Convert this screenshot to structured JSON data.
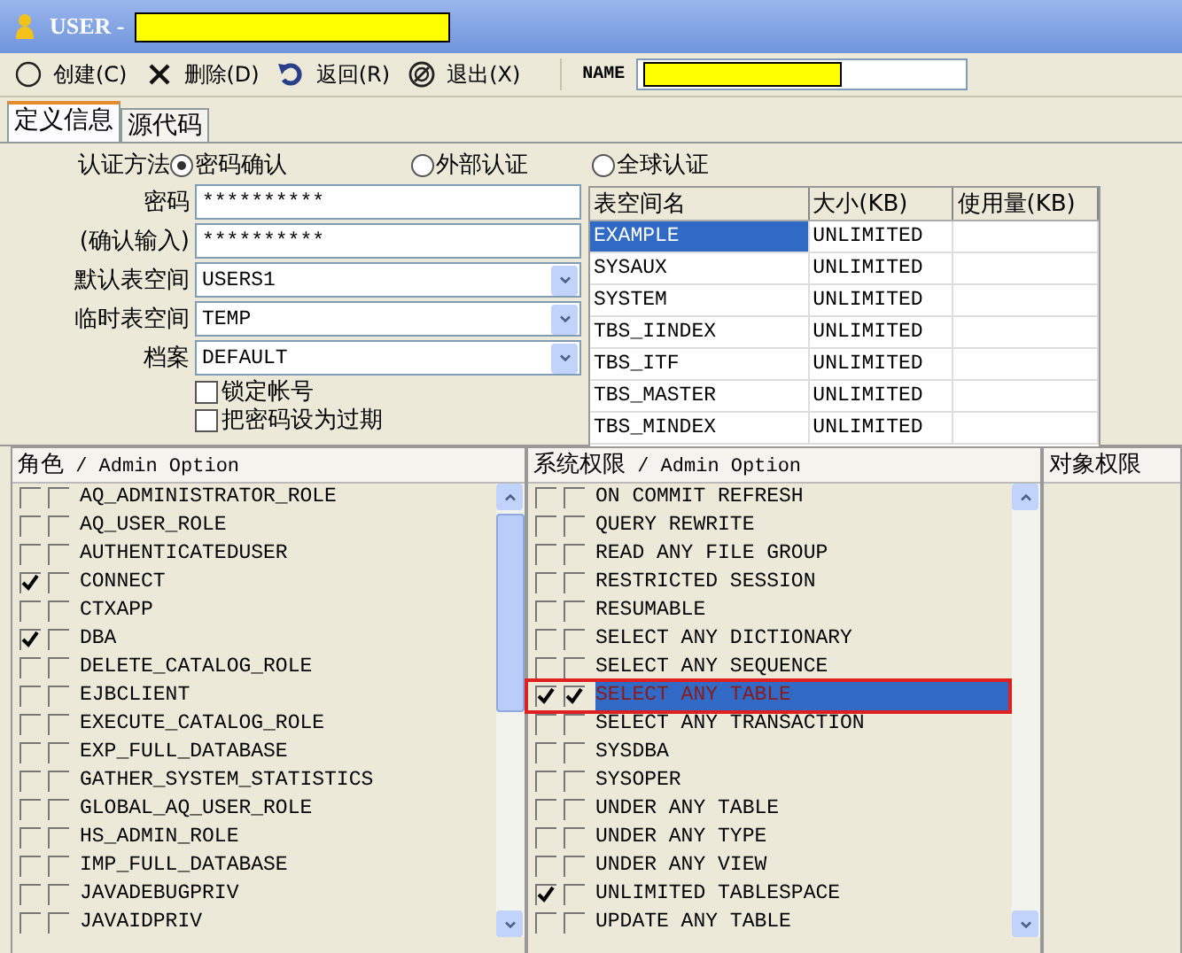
{
  "window": {
    "title": "USER -",
    "redacted": true
  },
  "toolbar": {
    "buttons": [
      {
        "label": "创建(C)"
      },
      {
        "label": "删除(D)"
      },
      {
        "label": "返回(R)"
      },
      {
        "label": "退出(X)"
      }
    ],
    "name_field": {
      "label": "NAME",
      "redacted": true
    }
  },
  "tabs": [
    {
      "label": "定义信息",
      "selected": true
    },
    {
      "label": "源代码",
      "selected": false
    }
  ],
  "auth": {
    "label": "认证方法",
    "options": [
      {
        "label": "密码确认",
        "selected": true
      },
      {
        "label": "外部认证",
        "selected": false
      },
      {
        "label": "全球认证",
        "selected": false
      }
    ]
  },
  "fields": [
    {
      "label": "密码",
      "kind": "password",
      "value": "**********"
    },
    {
      "label": "(确认输入)",
      "kind": "password",
      "value": "**********"
    },
    {
      "label": "默认表空间",
      "kind": "select",
      "value": "USERS1"
    },
    {
      "label": "临时表空间",
      "kind": "select",
      "value": "TEMP"
    },
    {
      "label": "档案",
      "kind": "select",
      "value": "DEFAULT"
    }
  ],
  "checkboxes": [
    {
      "label": "锁定帐号",
      "checked": false
    },
    {
      "label": "把密码设为过期",
      "checked": false
    }
  ],
  "tablespaces": {
    "columns": [
      "表空间名",
      "大小(KB)",
      "使用量(KB)"
    ],
    "rows": [
      {
        "name": "EXAMPLE",
        "size": "UNLIMITED",
        "selected": true
      },
      {
        "name": "SYSAUX",
        "size": "UNLIMITED",
        "selected": false
      },
      {
        "name": "SYSTEM",
        "size": "UNLIMITED",
        "selected": false
      },
      {
        "name": "TBS_IINDEX",
        "size": "UNLIMITED",
        "selected": false
      },
      {
        "name": "TBS_ITF",
        "size": "UNLIMITED",
        "selected": false
      },
      {
        "name": "TBS_MASTER",
        "size": "UNLIMITED",
        "selected": false
      },
      {
        "name": "TBS_MINDEX",
        "size": "UNLIMITED",
        "selected": false
      }
    ]
  },
  "roles": {
    "header": "角色 / Admin Option",
    "rows": [
      {
        "name": "AQ_ADMINISTRATOR_ROLE",
        "granted": false,
        "admin": false
      },
      {
        "name": "AQ_USER_ROLE",
        "granted": false,
        "admin": false
      },
      {
        "name": "AUTHENTICATEDUSER",
        "granted": false,
        "admin": false
      },
      {
        "name": "CONNECT",
        "granted": true,
        "admin": false
      },
      {
        "name": "CTXAPP",
        "granted": false,
        "admin": false
      },
      {
        "name": "DBA",
        "granted": true,
        "admin": false
      },
      {
        "name": "DELETE_CATALOG_ROLE",
        "granted": false,
        "admin": false
      },
      {
        "name": "EJBCLIENT",
        "granted": false,
        "admin": false
      },
      {
        "name": "EXECUTE_CATALOG_ROLE",
        "granted": false,
        "admin": false
      },
      {
        "name": "EXP_FULL_DATABASE",
        "granted": false,
        "admin": false
      },
      {
        "name": "GATHER_SYSTEM_STATISTICS",
        "granted": false,
        "admin": false
      },
      {
        "name": "GLOBAL_AQ_USER_ROLE",
        "granted": false,
        "admin": false
      },
      {
        "name": "HS_ADMIN_ROLE",
        "granted": false,
        "admin": false
      },
      {
        "name": "IMP_FULL_DATABASE",
        "granted": false,
        "admin": false
      },
      {
        "name": "JAVADEBUGPRIV",
        "granted": false,
        "admin": false
      },
      {
        "name": "JAVAIDPRIV",
        "granted": false,
        "admin": false
      }
    ]
  },
  "system_privileges": {
    "header": "系统权限 / Admin Option",
    "rows": [
      {
        "name": "ON COMMIT REFRESH",
        "granted": false,
        "admin": false,
        "selected": false,
        "highlighted": false
      },
      {
        "name": "QUERY REWRITE",
        "granted": false,
        "admin": false,
        "selected": false,
        "highlighted": false
      },
      {
        "name": "READ ANY FILE GROUP",
        "granted": false,
        "admin": false,
        "selected": false,
        "highlighted": false
      },
      {
        "name": "RESTRICTED SESSION",
        "granted": false,
        "admin": false,
        "selected": false,
        "highlighted": false
      },
      {
        "name": "RESUMABLE",
        "granted": false,
        "admin": false,
        "selected": false,
        "highlighted": false
      },
      {
        "name": "SELECT ANY DICTIONARY",
        "granted": false,
        "admin": false,
        "selected": false,
        "highlighted": false
      },
      {
        "name": "SELECT ANY SEQUENCE",
        "granted": false,
        "admin": false,
        "selected": false,
        "highlighted": false
      },
      {
        "name": "SELECT ANY TABLE",
        "granted": true,
        "admin": true,
        "selected": true,
        "highlighted": true
      },
      {
        "name": "SELECT ANY TRANSACTION",
        "granted": false,
        "admin": false,
        "selected": false,
        "highlighted": false
      },
      {
        "name": "SYSDBA",
        "granted": false,
        "admin": false,
        "selected": false,
        "highlighted": false
      },
      {
        "name": "SYSOPER",
        "granted": false,
        "admin": false,
        "selected": false,
        "highlighted": false
      },
      {
        "name": "UNDER ANY TABLE",
        "granted": false,
        "admin": false,
        "selected": false,
        "highlighted": false
      },
      {
        "name": "UNDER ANY TYPE",
        "granted": false,
        "admin": false,
        "selected": false,
        "highlighted": false
      },
      {
        "name": "UNDER ANY VIEW",
        "granted": false,
        "admin": false,
        "selected": false,
        "highlighted": false
      },
      {
        "name": "UNLIMITED TABLESPACE",
        "granted": true,
        "admin": false,
        "selected": false,
        "highlighted": false
      },
      {
        "name": "UPDATE ANY TABLE",
        "granted": false,
        "admin": false,
        "selected": false,
        "highlighted": false
      }
    ]
  },
  "object_privileges": {
    "header": "对象权限"
  }
}
